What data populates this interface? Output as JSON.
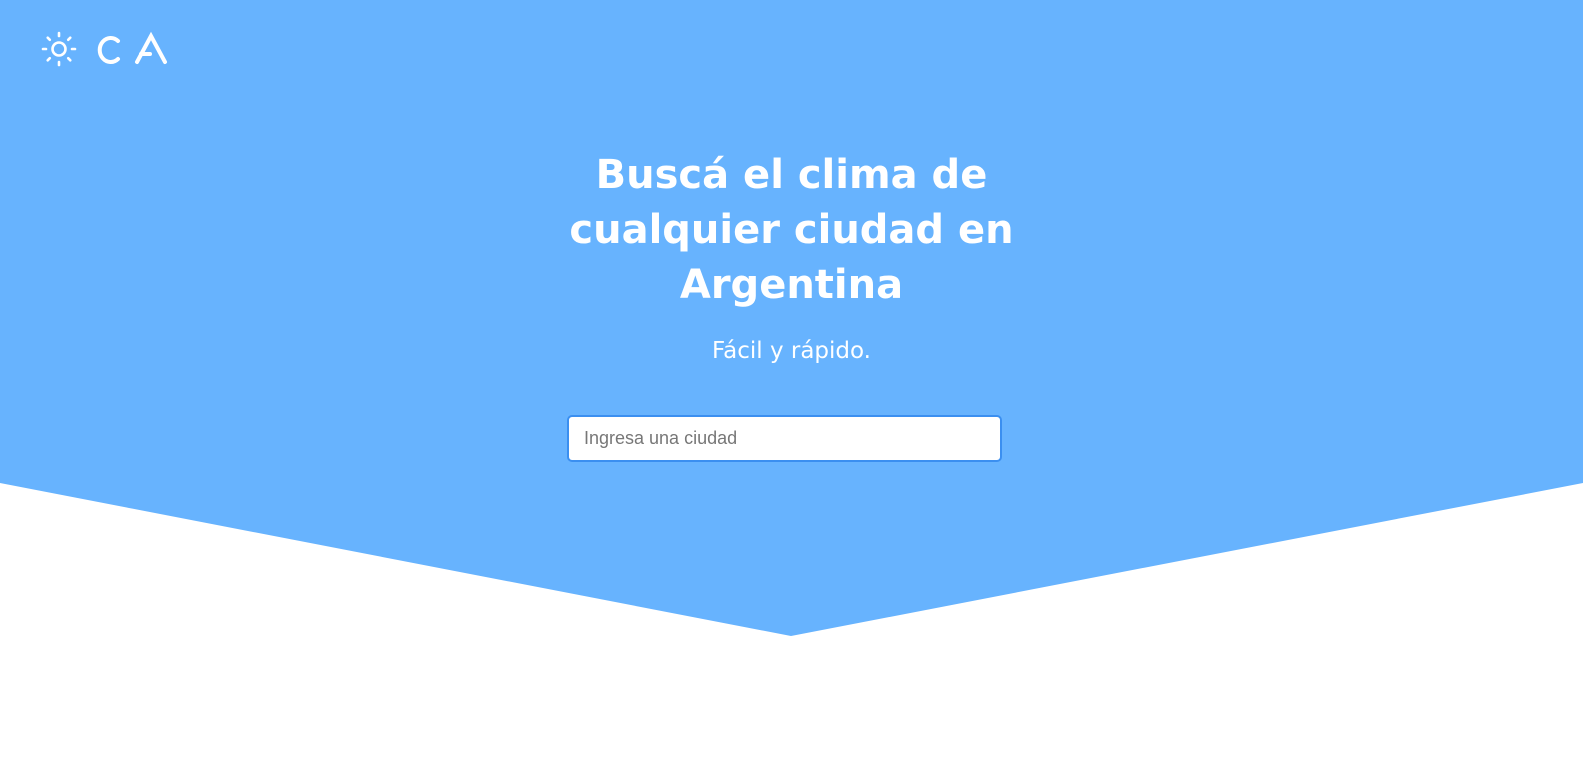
{
  "colors": {
    "hero_background": "#67b3fe",
    "text": "#ffffff",
    "input_border": "#3b8ff0"
  },
  "header": {
    "logo_icon": "sun-icon",
    "logo_text": "CA"
  },
  "hero": {
    "headline_lines": [
      "Buscá el clima de",
      "cualquier ciudad en",
      "Argentina"
    ],
    "subtitle": "Fácil y rápido."
  },
  "search": {
    "placeholder": "Ingresa una ciudad",
    "value": ""
  }
}
